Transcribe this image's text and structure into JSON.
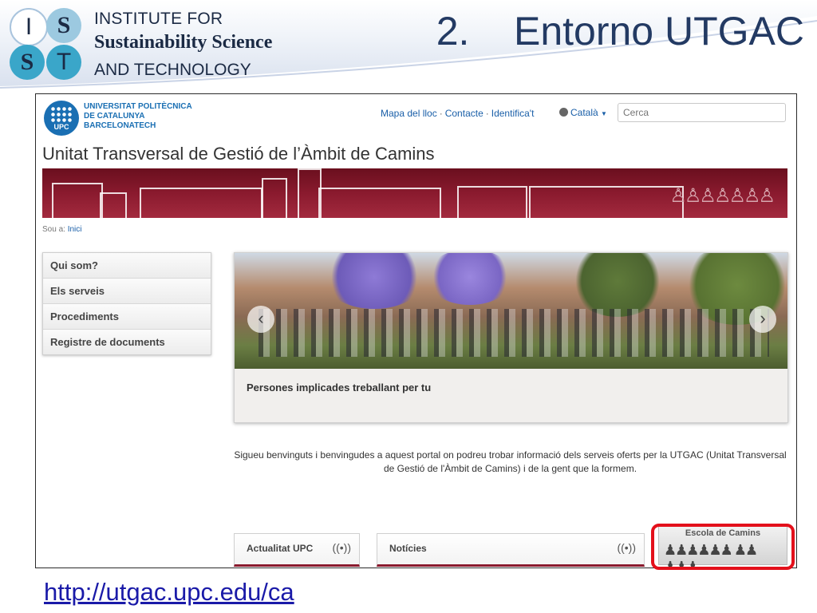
{
  "slide": {
    "logo_letters": [
      "I",
      "S",
      "S",
      "T"
    ],
    "logo_colors": [
      "#ffffff",
      "#9cc9e0",
      "#3aa6c9",
      "#3aa6c9"
    ],
    "logo_line1": "INSTITUTE FOR",
    "logo_line2": "Sustainability Science",
    "logo_line3": "AND TECHNOLOGY",
    "title": "2.    Entorno UTGAC",
    "url": "http://utgac.upc.edu/ca"
  },
  "site": {
    "university_line1": "UNIVERSITAT POLITÈCNICA",
    "university_line2": "DE CATALUNYA",
    "university_line3": "BARCELONATECH",
    "upc_abbrev": "UPC",
    "top_links": [
      "Mapa del lloc",
      "Contacte",
      "Identifica't"
    ],
    "top_links_separator": "·",
    "language": "Català",
    "search_placeholder": "Cerca",
    "site_title": "Unitat Transversal de Gestió de l’Àmbit de Camins",
    "breadcrumb_prefix": "Sou a:",
    "breadcrumb_link": "Inici",
    "nav_items": [
      "Qui som?",
      "Els serveis",
      "Procediments",
      "Registre de documents"
    ],
    "carousel_caption": "Persones implicades treballant per tu",
    "welcome_text": "Sigueu benvinguts i benvingudes a aquest portal on podreu trobar informació dels serveis oferts per la UTGAC (Unitat Transversal de Gestió de l'Àmbit de Camins) i de la gent que la formem.",
    "box1": "Actualitat UPC",
    "box2": "Notícies",
    "escola": "Escola de Camins",
    "colors": {
      "accent_red": "#8a1a2e",
      "link_blue": "#1a5fa8",
      "highlight": "#e3101b"
    }
  }
}
